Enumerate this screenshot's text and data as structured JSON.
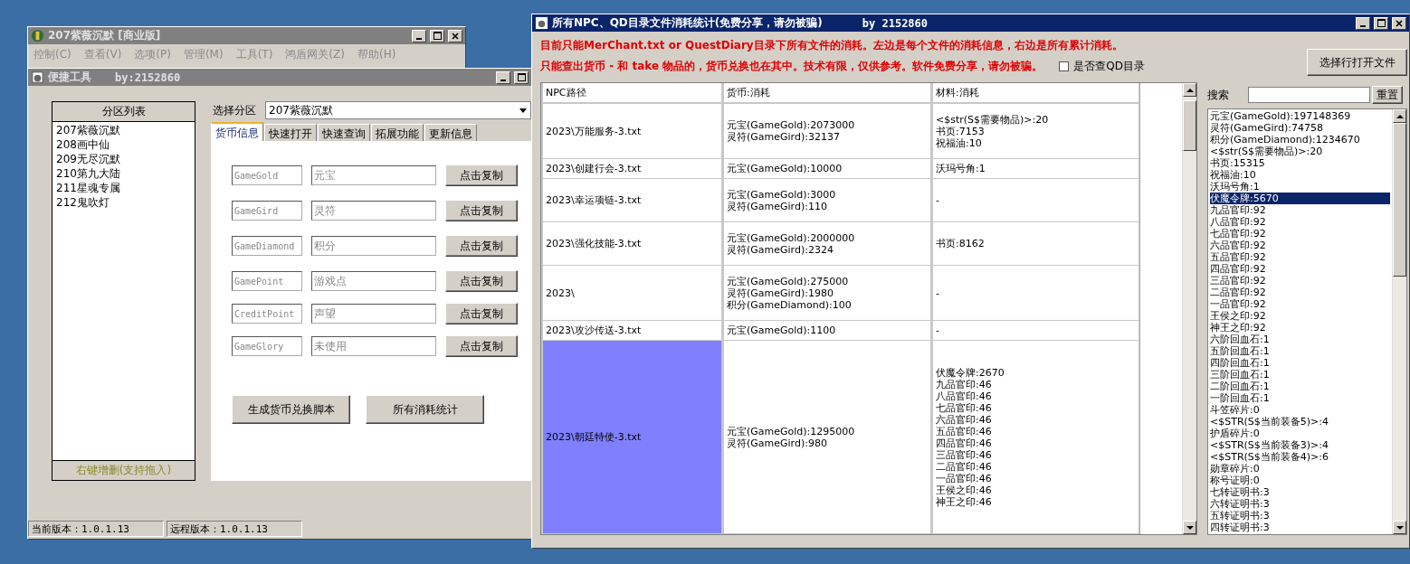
{
  "main_window": {
    "title": "207紫薇沉默 [商业版]",
    "menu": [
      {
        "label": "控制(C)",
        "disabled": true
      },
      {
        "label": "查看(V)",
        "disabled": true
      },
      {
        "label": "选项(P)",
        "disabled": true
      },
      {
        "label": "管理(M)",
        "disabled": true
      },
      {
        "label": "工具(T)",
        "disabled": true
      },
      {
        "label": "鸿盾网关(Z)",
        "disabled": true
      },
      {
        "label": "帮助(H)",
        "disabled": true
      }
    ]
  },
  "tool_window": {
    "title": "便捷工具",
    "author": "by:2152860",
    "partition_list": {
      "header": "分区列表",
      "items": [
        "207紫薇沉默",
        "208画中仙",
        "209无尽沉默",
        "210第九大陆",
        "211星魂专属",
        "212鬼吹灯"
      ],
      "footer": "右键增删(支持拖入)"
    },
    "partition_select": {
      "label": "选择分区",
      "value": "207紫薇沉默"
    },
    "tabs": [
      {
        "label": "货币信息",
        "selected": true
      },
      {
        "label": "快速打开",
        "selected": false
      },
      {
        "label": "快速查询",
        "selected": false
      },
      {
        "label": "拓展功能",
        "selected": false
      },
      {
        "label": "更新信息",
        "selected": false
      }
    ],
    "currency_rows": [
      {
        "key": "GameGold",
        "name": "元宝",
        "button": "点击复制"
      },
      {
        "key": "GameGird",
        "name": "灵符",
        "button": "点击复制"
      },
      {
        "key": "GameDiamond",
        "name": "积分",
        "button": "点击复制"
      },
      {
        "key": "GamePoint",
        "name": "游戏点",
        "button": "点击复制"
      },
      {
        "key": "CreditPoint",
        "name": "声望",
        "button": "点击复制"
      },
      {
        "key": "GameGlory",
        "name": "未使用",
        "button": "点击复制"
      }
    ],
    "actions": [
      "生成货币兑换脚本",
      "所有消耗统计"
    ],
    "status_bar": [
      "当前版本：1.0.1.13",
      "远程版本：1.0.1.13"
    ]
  },
  "stats_window": {
    "title": "所有NPC、QD目录文件消耗统计(免费分享，请勿被骗)",
    "author": "by 2152860",
    "notes": [
      "目前只能MerChant.txt or QuestDiary目录下所有文件的消耗。左边是每个文件的消耗信息，右边是所有累计消耗。",
      "只能查出货币 - 和 take 物品的，货币兑换也在其中。技术有限，仅供参考。软件免费分享，请勿被骗。"
    ],
    "qd_checkbox": {
      "label": "是否查QD目录",
      "checked": false
    },
    "open_button": "选择行打开文件",
    "table": {
      "columns": [
        "NPC路径",
        "货币:消耗",
        "材料:消耗"
      ],
      "rows": [
        {
          "path": "2023\\万能服务-3.txt",
          "currency": [
            "元宝(GameGold):2073000",
            "灵符(GameGird):32137"
          ],
          "materials": [
            "<$str(S$需要物品)>:20",
            "书页:7153",
            "祝福油:10"
          ],
          "selected": false
        },
        {
          "path": "2023\\创建行会-3.txt",
          "currency": [
            "元宝(GameGold):10000"
          ],
          "materials": [
            "沃玛号角:1"
          ],
          "selected": false
        },
        {
          "path": "2023\\幸运项链-3.txt",
          "currency": [
            "元宝(GameGold):3000",
            "灵符(GameGird):110"
          ],
          "materials": [
            "-"
          ],
          "selected": false
        },
        {
          "path": "2023\\强化技能-3.txt",
          "currency": [
            "元宝(GameGold):2000000",
            "灵符(GameGird):2324"
          ],
          "materials": [
            "书页:8162"
          ],
          "selected": false
        },
        {
          "path": "2023\\",
          "currency": [
            "元宝(GameGold):275000",
            "灵符(GameGird):1980",
            "积分(GameDiamond):100"
          ],
          "materials": [
            "-"
          ],
          "selected": false
        },
        {
          "path": "2023\\攻沙传送-3.txt",
          "currency": [
            "元宝(GameGold):1100"
          ],
          "materials": [
            "-"
          ],
          "selected": false
        },
        {
          "path": "2023\\朝廷特使-3.txt",
          "currency": [
            "元宝(GameGold):1295000",
            "灵符(GameGird):980"
          ],
          "materials": [
            "伏魔令牌:2670",
            "九品官印:46",
            "八品官印:46",
            "七品官印:46",
            "六品官印:46",
            "五品官印:46",
            "四品官印:46",
            "三品官印:46",
            "二品官印:46",
            "一品官印:46",
            "王侯之印:46",
            "神王之印:46"
          ],
          "selected": true
        }
      ]
    },
    "search": {
      "label": "搜索",
      "button": "重置"
    },
    "totals": [
      {
        "text": "元宝(GameGold):197148369",
        "selected": false
      },
      {
        "text": "灵符(GameGird):74758",
        "selected": false
      },
      {
        "text": "积分(GameDiamond):1234670",
        "selected": false
      },
      {
        "text": "<$str(S$需要物品)>:20",
        "selected": false
      },
      {
        "text": "书页:15315",
        "selected": false
      },
      {
        "text": "祝福油:10",
        "selected": false
      },
      {
        "text": "沃玛号角:1",
        "selected": false
      },
      {
        "text": "伏魔令牌:5670",
        "selected": true
      },
      {
        "text": "九品官印:92",
        "selected": false
      },
      {
        "text": "八品官印:92",
        "selected": false
      },
      {
        "text": "七品官印:92",
        "selected": false
      },
      {
        "text": "六品官印:92",
        "selected": false
      },
      {
        "text": "五品官印:92",
        "selected": false
      },
      {
        "text": "四品官印:92",
        "selected": false
      },
      {
        "text": "三品官印:92",
        "selected": false
      },
      {
        "text": "二品官印:92",
        "selected": false
      },
      {
        "text": "一品官印:92",
        "selected": false
      },
      {
        "text": "王侯之印:92",
        "selected": false
      },
      {
        "text": "神王之印:92",
        "selected": false
      },
      {
        "text": "六阶回血石:1",
        "selected": false
      },
      {
        "text": "五阶回血石:1",
        "selected": false
      },
      {
        "text": "四阶回血石:1",
        "selected": false
      },
      {
        "text": "三阶回血石:1",
        "selected": false
      },
      {
        "text": "二阶回血石:1",
        "selected": false
      },
      {
        "text": "一阶回血石:1",
        "selected": false
      },
      {
        "text": "斗笠碎片:0",
        "selected": false
      },
      {
        "text": "<$STR(S$当前装备5)>:4",
        "selected": false
      },
      {
        "text": "护盾碎片:0",
        "selected": false
      },
      {
        "text": "<$STR(S$当前装备3)>:4",
        "selected": false
      },
      {
        "text": "<$STR(S$当前装备4)>:6",
        "selected": false
      },
      {
        "text": "勋章碎片:0",
        "selected": false
      },
      {
        "text": "称号证明:0",
        "selected": false
      },
      {
        "text": "七转证明书:3",
        "selected": false
      },
      {
        "text": "六转证明书:3",
        "selected": false
      },
      {
        "text": "五转证明书:3",
        "selected": false
      },
      {
        "text": "四转证明书:3",
        "selected": false
      }
    ]
  }
}
